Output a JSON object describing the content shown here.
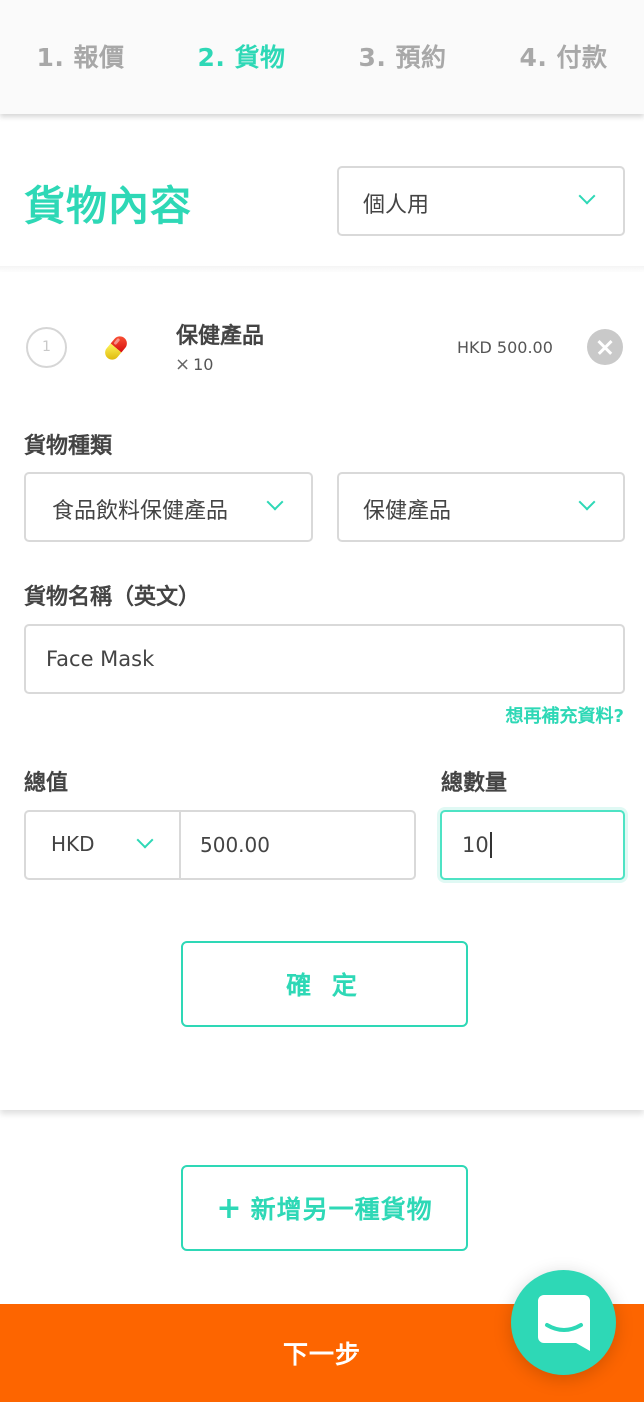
{
  "stepper": {
    "steps": [
      {
        "label": "1. 報價",
        "active": false
      },
      {
        "label": "2. 貨物",
        "active": true
      },
      {
        "label": "3. 預約",
        "active": false
      },
      {
        "label": "4. 付款",
        "active": false
      }
    ]
  },
  "section": {
    "title": "貨物內容",
    "usage_select": {
      "value": "個人用"
    }
  },
  "item": {
    "index": "1",
    "icon": "pill-icon",
    "name": "保健產品",
    "qty_prefix": "×",
    "qty": "10",
    "price": "HKD 500.00"
  },
  "form": {
    "category_label": "貨物種類",
    "category_value": "食品飲料保健產品",
    "subcategory_value": "保健產品",
    "name_label": "貨物名稱（英文）",
    "name_value": "Face Mask",
    "more_info_link": "想再補充資料?",
    "total_value_label": "總值",
    "currency_value": "HKD",
    "amount_value": "500.00",
    "total_qty_label": "總數量",
    "qty_value": "10",
    "confirm_label": "確 定"
  },
  "actions": {
    "add_plus": "+",
    "add_label": "新增另一種貨物",
    "next_label": "下一步"
  },
  "colors": {
    "accent": "#2ed8b6",
    "primary_cta": "#fd6500",
    "muted": "#a8a8a8"
  }
}
